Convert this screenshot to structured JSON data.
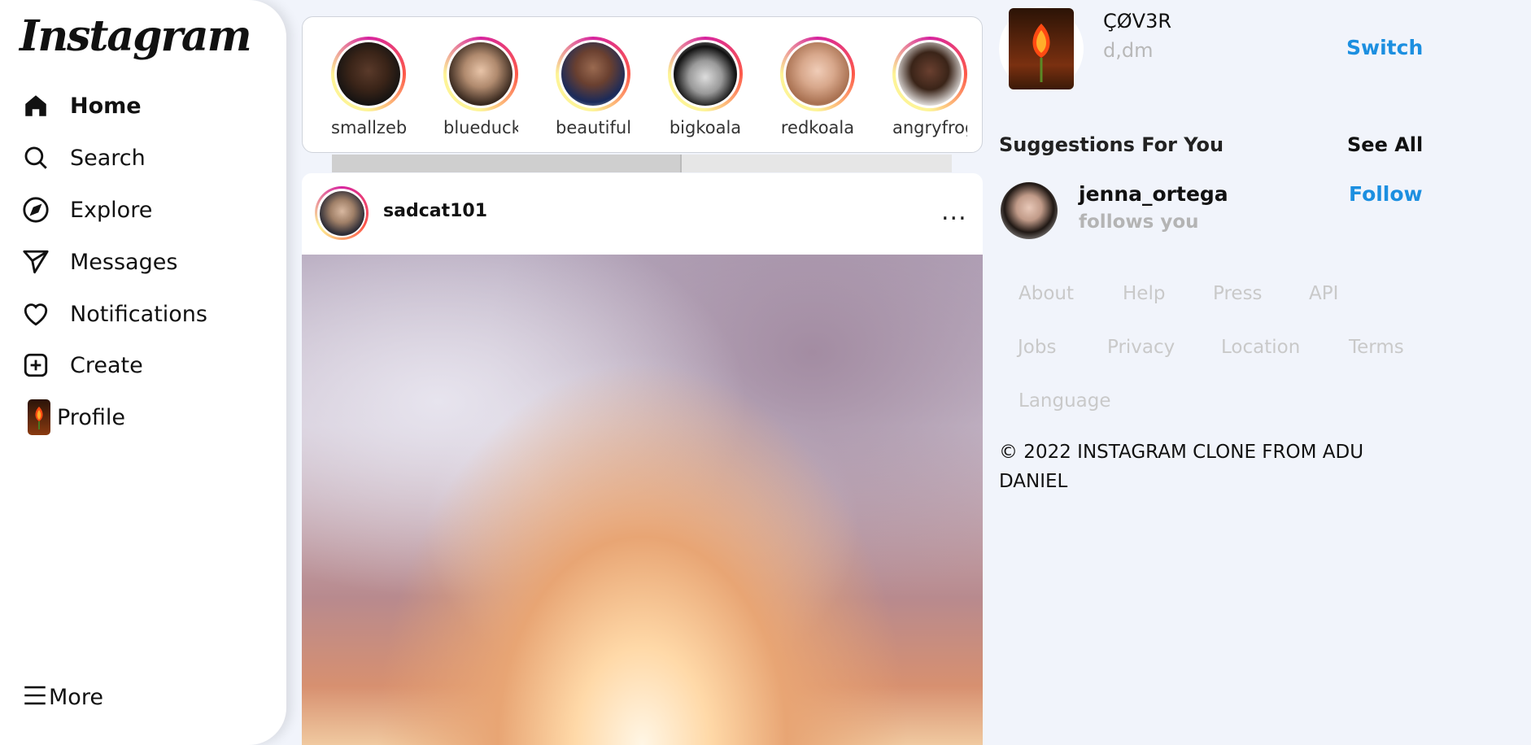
{
  "app": {
    "logo": "Instagram"
  },
  "sidebar": {
    "items": [
      {
        "label": "Home",
        "icon": "home-icon"
      },
      {
        "label": "Search",
        "icon": "search-icon"
      },
      {
        "label": "Explore",
        "icon": "compass-icon"
      },
      {
        "label": "Messages",
        "icon": "send-icon"
      },
      {
        "label": "Notifications",
        "icon": "heart-icon"
      },
      {
        "label": "Create",
        "icon": "plus-square-icon"
      },
      {
        "label": "Profile",
        "icon": "profile-avatar"
      }
    ],
    "more_label": "More"
  },
  "stories": [
    {
      "name": "smallzebra"
    },
    {
      "name": "blueduck"
    },
    {
      "name": "beautiful"
    },
    {
      "name": "bigkoala"
    },
    {
      "name": "redkoala"
    },
    {
      "name": "angryfrog"
    }
  ],
  "post": {
    "username": "sadcat101",
    "more": "..."
  },
  "me": {
    "username": "ÇØV3R",
    "name": "d,dm",
    "switch_label": "Switch"
  },
  "suggestions": {
    "title": "Suggestions For You",
    "see_all": "See All",
    "items": [
      {
        "username": "jenna_ortega",
        "subtitle": "follows you",
        "action": "Follow"
      }
    ]
  },
  "footer": {
    "links": [
      "About",
      "Help",
      "Press",
      "API",
      "Jobs",
      "Privacy",
      "Location",
      "Terms",
      "Language"
    ],
    "copyright": "© 2022 INSTAGRAM CLONE FROM ADU DANIEL"
  },
  "colors": {
    "accent": "#1c8fe0",
    "background": "#f1f4fb"
  }
}
